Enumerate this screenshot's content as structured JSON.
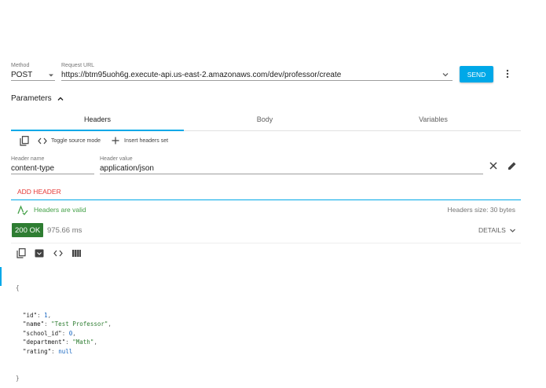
{
  "request": {
    "method_label": "Method",
    "method_value": "POST",
    "url_label": "Request URL",
    "url_value": "https://btm95uoh6g.execute-api.us-east-2.amazonaws.com/dev/professor/create",
    "send_label": "SEND"
  },
  "parameters": {
    "title": "Parameters",
    "tabs": [
      {
        "label": "Headers"
      },
      {
        "label": "Body"
      },
      {
        "label": "Variables"
      }
    ]
  },
  "headers_toolbar": {
    "toggle_label": "Toggle source mode",
    "insert_label": "Insert headers set"
  },
  "header_row": {
    "name_label": "Header name",
    "name_value": "content-type",
    "value_label": "Header value",
    "value_value": "application/json"
  },
  "add_header_label": "ADD HEADER",
  "validation": {
    "text": "Headers are valid",
    "size_text": "Headers size: 30 bytes"
  },
  "response": {
    "status": "200 OK",
    "time": "975.66 ms",
    "details_label": "DETAILS"
  },
  "response_body": {
    "open": "{",
    "close": "}",
    "fields": [
      {
        "key": "\"id\"",
        "value": "1",
        "type": "number",
        "comma": ","
      },
      {
        "key": "\"name\"",
        "value": "\"Test Professor\"",
        "type": "string",
        "comma": ","
      },
      {
        "key": "\"school_id\"",
        "value": "0",
        "type": "number",
        "comma": ","
      },
      {
        "key": "\"department\"",
        "value": "\"Math\"",
        "type": "string",
        "comma": ","
      },
      {
        "key": "\"rating\"",
        "value": "null",
        "type": "number",
        "comma": ""
      }
    ]
  },
  "colors": {
    "accent": "#00a8e8",
    "status_ok": "#2e7d32",
    "add_header": "#e53935",
    "valid": "#43a047"
  }
}
